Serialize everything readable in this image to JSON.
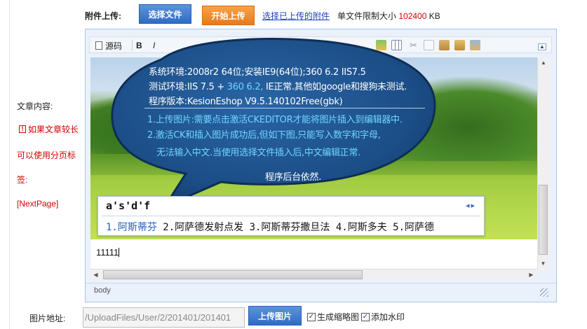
{
  "attach": {
    "label": "附件上传:",
    "select_button": "选择文件",
    "start_button": "开始上传",
    "select_uploaded_link": "选择已上传的附件",
    "limit_prefix": "单文件限制大小",
    "limit_value": "102400",
    "limit_unit": "KB"
  },
  "left": {
    "content_label": "文章内容:",
    "hint_line1": "如果文章较长",
    "hint_line2": "可以使用分页标",
    "hint_line3": "签:",
    "hint_line4": "[NextPage]"
  },
  "toolbar": {
    "source_label": "源码",
    "bold_label": "B",
    "italic_label": "I",
    "collapse_glyph": "▲"
  },
  "bubble": {
    "line1": "系统环境:2008r2  64位;安装IE9(64位);360 6.2 IIS7.5",
    "line2a": "测试环境:IIS 7.5 + ",
    "line2b": "360 6.2,",
    "line2c": " IE正常.其他如google和搜狗未测试.",
    "line3": "程序版本:KesionEshop V9.5.140102Free(gbk)",
    "line4": "1.上传图片:需要点击激活CKEDITOR才能将图片插入到编辑器中.",
    "line5": "2.激活CK和插入图片成功后,但如下图,只能写入数字和字母,",
    "line6": "无法输入中文.当使用选择文件插入后,中文编辑正常.",
    "line7": "程序后台依然."
  },
  "ime": {
    "input_text": "a's'd'f",
    "arrows": "◂▸",
    "candidate1": "1.阿斯蒂芬",
    "candidates_rest": " 2.阿萨德发射点发  3.阿斯蒂芬撒旦法  4.阿斯多夫  5.阿萨德"
  },
  "editor": {
    "body_text": "11111",
    "status_path": "body"
  },
  "bottom": {
    "image_label": "图片地址:",
    "image_path_value": "/UploadFiles/User/2/201401/201401",
    "upload_button": "上传图片",
    "thumb_checkbox_label": "生成缩略图",
    "watermark_checkbox_label": "添加水印",
    "thumb_checked": true,
    "watermark_checked": true
  },
  "colors": {
    "button_blue": "#2f6cc6",
    "button_orange": "#e8791c",
    "hint_red": "#d40000",
    "bubble_fill": "#1d4f86",
    "link_blue": "#1f3fbf"
  }
}
